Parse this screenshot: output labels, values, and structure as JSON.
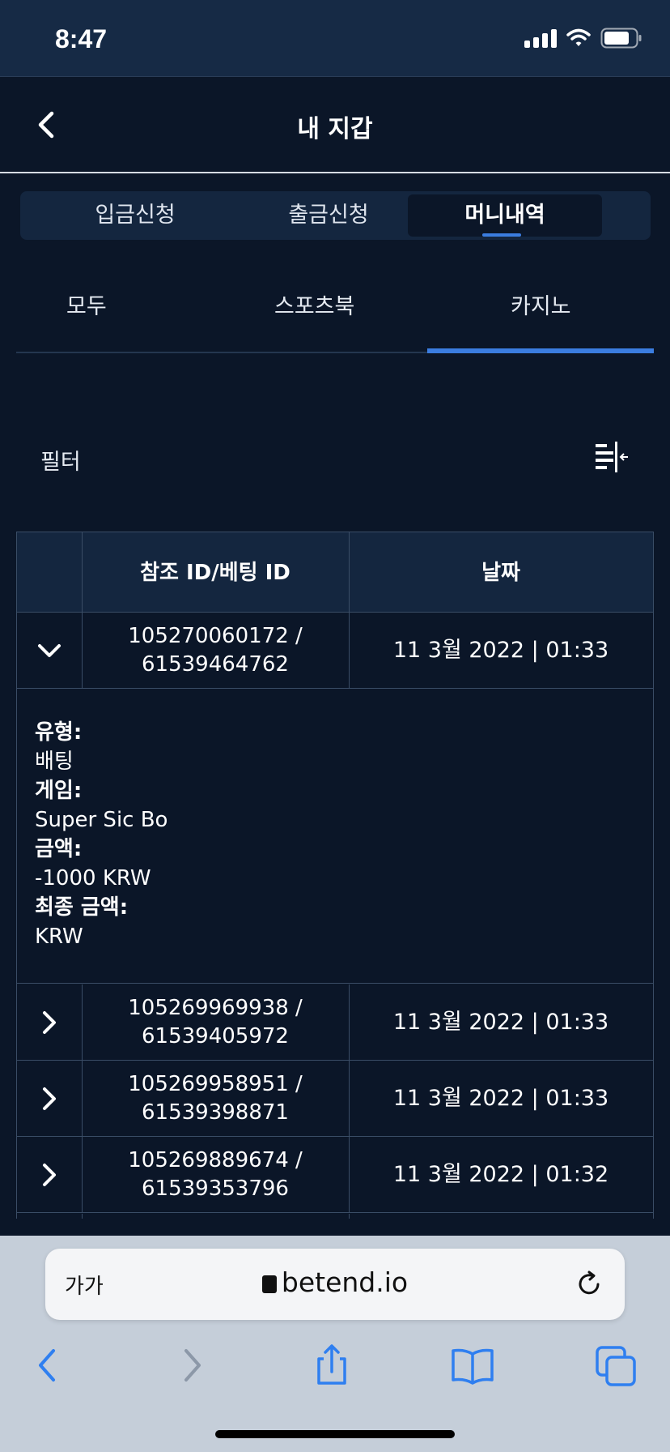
{
  "status_bar": {
    "time": "8:47"
  },
  "header": {
    "title": "내 지갑"
  },
  "top_tabs": [
    {
      "label": "입금신청",
      "active": false
    },
    {
      "label": "출금신청",
      "active": false
    },
    {
      "label": "머니내역",
      "active": true
    }
  ],
  "sub_tabs": [
    {
      "label": "모두",
      "active": false
    },
    {
      "label": "스포츠북",
      "active": false
    },
    {
      "label": "카지노",
      "active": true
    }
  ],
  "filter": {
    "label": "필터"
  },
  "table": {
    "headers": {
      "reference": "참조 ID/베팅 ID",
      "date": "날짜"
    },
    "rows": [
      {
        "ref_id": "105270060172 /",
        "bet_id": "61539464762",
        "date": "11 3월 2022 | 01:33",
        "expanded": true
      },
      {
        "ref_id": "105269969938 /",
        "bet_id": "61539405972",
        "date": "11 3월 2022 | 01:33",
        "expanded": false
      },
      {
        "ref_id": "105269958951 /",
        "bet_id": "61539398871",
        "date": "11 3월 2022 | 01:33",
        "expanded": false
      },
      {
        "ref_id": "105269889674 /",
        "bet_id": "61539353796",
        "date": "11 3월 2022 | 01:32",
        "expanded": false
      }
    ],
    "details": {
      "type_label": "유형:",
      "type_value": "배팅",
      "game_label": "게임:",
      "game_value": "Super Sic Bo",
      "amount_label": "금액:",
      "amount_value": "-1000 KRW",
      "final_label": "최종 금액:",
      "final_value": "KRW"
    }
  },
  "browser": {
    "text_size_label": "가가",
    "url": "betend.io"
  },
  "colors": {
    "background": "#0b1628",
    "panel": "#14263f",
    "accent": "#3b7de0",
    "safari_toolbar": "#c5ced9",
    "safari_icon": "#2f7ff0"
  },
  "icons": [
    "back-chevron-icon",
    "filter-icon",
    "chevron-down-icon",
    "chevron-right-icon",
    "lock-icon",
    "reload-icon",
    "share-icon",
    "bookmarks-icon",
    "tabs-icon",
    "signal-icon",
    "wifi-icon",
    "battery-icon"
  ]
}
